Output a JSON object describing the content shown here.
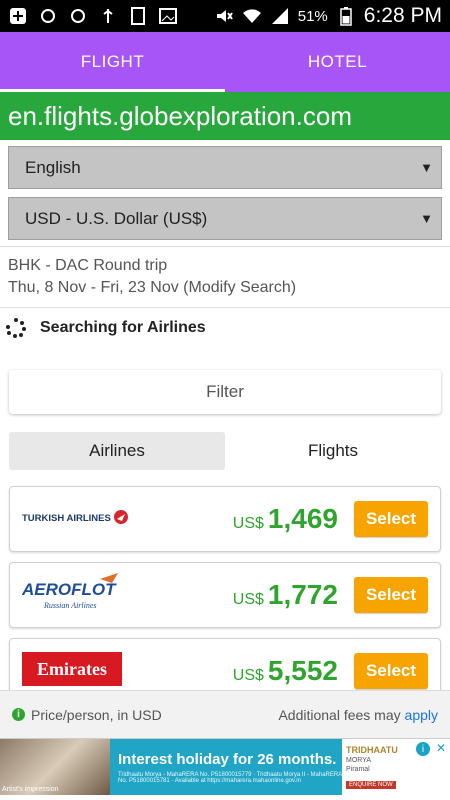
{
  "status_bar": {
    "battery_percent": "51%",
    "time": "6:28 PM"
  },
  "tabs": [
    {
      "label": "FLIGHT",
      "active": true
    },
    {
      "label": "HOTEL",
      "active": false
    }
  ],
  "site": {
    "domain": "en.flights.globexploration.com"
  },
  "selects": {
    "language": "English",
    "currency": "USD - U.S. Dollar (US$)"
  },
  "search": {
    "route": "BHK - DAC Round trip",
    "dates": "Thu, 8 Nov - Fri, 23 Nov (Modify Search)",
    "status": "Searching for Airlines"
  },
  "filter_label": "Filter",
  "segmented": {
    "airlines": "Airlines",
    "flights": "Flights",
    "active": "airlines"
  },
  "results": [
    {
      "airline": "TURKISH AIRLINES",
      "currency": "US$",
      "price": "1,469",
      "button": "Select"
    },
    {
      "airline": "AEROFLOT",
      "sub": "Russian Airlines",
      "currency": "US$",
      "price": "1,772",
      "button": "Select"
    },
    {
      "airline": "Emirates",
      "currency": "US$",
      "price": "5,552",
      "button": "Select"
    }
  ],
  "footer": {
    "price_note": "Price/person, in USD",
    "fees_text": "Additional fees may",
    "fees_link": "apply"
  },
  "ad": {
    "headline": "Interest holiday for 26 months.",
    "image_credit": "Artist's impression",
    "fine_print": "Tridhaatu Morya - MahaRERA No. P51800015779 · Tridhaatu Morya II - MahaRERA No. P51800015781 · Available at https://maharera.mahaonline.gov.in",
    "brand": "TRIDHAATU",
    "brand_sub": "MORYA",
    "partner": "Piramal",
    "cta": "ENQUIRE NOW"
  },
  "colors": {
    "tab_bar": "#a855f7",
    "domain_bar": "#28a83c",
    "price_green": "#2fa52f",
    "select_button": "#f7a400"
  }
}
